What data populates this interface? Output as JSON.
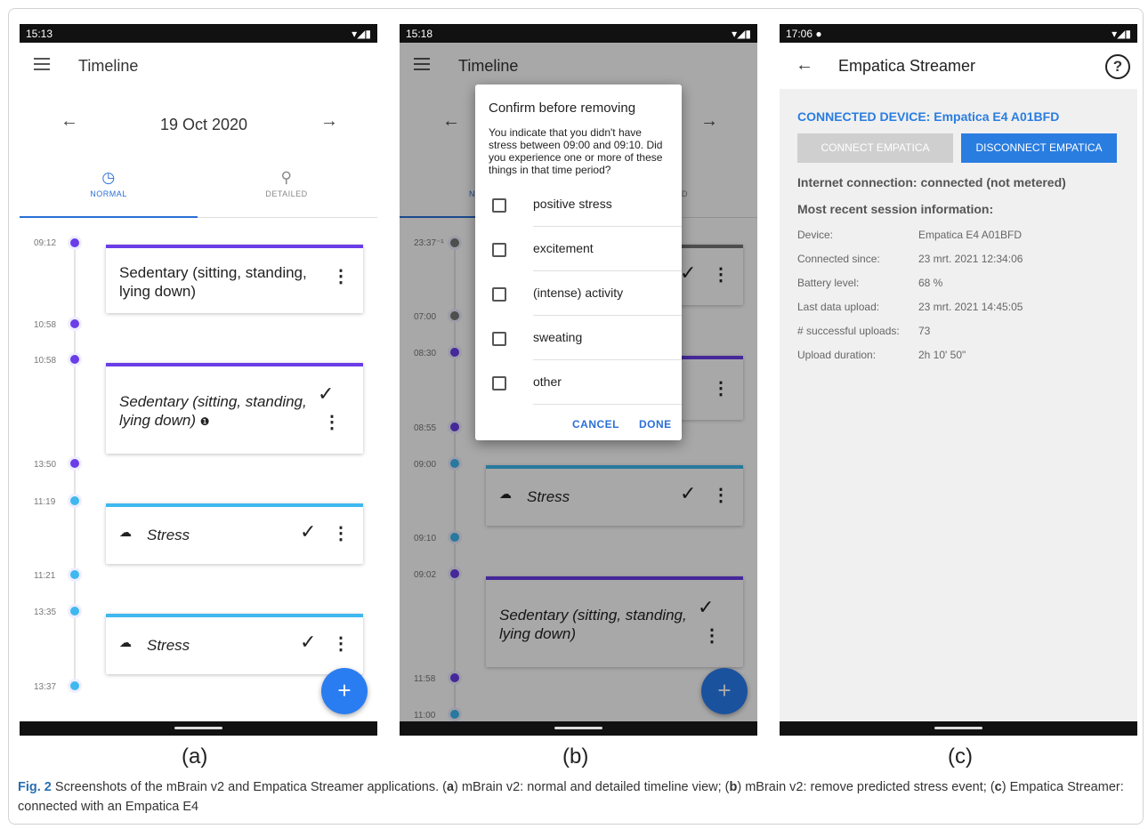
{
  "panel_a": {
    "status": {
      "time": "15:13"
    },
    "title": "Timeline",
    "date": "19 Oct 2020",
    "prev": "←",
    "next": "→",
    "tabs": [
      {
        "label": "NORMAL"
      },
      {
        "label": "DETAILED"
      }
    ],
    "times": [
      "09:12",
      "10:58",
      "10:58",
      "13:50",
      "11:19",
      "11:21",
      "13:35",
      "13:37"
    ],
    "cards": [
      {
        "text": "Sedentary (sitting, standing, lying down)"
      },
      {
        "text": "Sedentary (sitting, standing, lying down)"
      },
      {
        "text": "Stress"
      },
      {
        "text": "Stress"
      }
    ],
    "fab": "+",
    "label": "(a)"
  },
  "panel_b": {
    "status": {
      "time": "15:18"
    },
    "title": "Timeline",
    "prev": "←",
    "next": "→",
    "tab_fragment_1": "N",
    "tab_fragment_2": "D",
    "times": [
      "23:37⁻¹",
      "07:00",
      "08:30",
      "08:55",
      "09:00",
      "09:10",
      "09:02",
      "11:58",
      "11:00"
    ],
    "dialog": {
      "title": "Confirm before removing",
      "message": "You indicate that you didn't have stress between 09:00 and 09:10. Did you experience one or more of these things in that time period?",
      "options": [
        "positive stress",
        "excitement",
        "(intense) activity",
        "sweating",
        "other"
      ],
      "cancel": "CANCEL",
      "done": "DONE"
    },
    "cards": [
      {
        "text": "Stress"
      },
      {
        "text": "Sedentary (sitting, standing, lying down)"
      }
    ],
    "fab": "+",
    "label": "(b)"
  },
  "panel_c": {
    "status": {
      "time": "17:06"
    },
    "title": "Empatica Streamer",
    "back": "←",
    "help": "?",
    "connected_device": "CONNECTED DEVICE: Empatica E4 A01BFD",
    "connect_btn": "CONNECT EMPATICA",
    "disconnect_btn": "DISCONNECT EMPATICA",
    "internet": "Internet connection:  connected (not metered)",
    "recent": "Most recent session information:",
    "info": [
      {
        "k": "Device:",
        "v": "Empatica E4 A01BFD"
      },
      {
        "k": "Connected since:",
        "v": "23 mrt. 2021 12:34:06"
      },
      {
        "k": "Battery level:",
        "v": "68 %"
      },
      {
        "k": "Last data upload:",
        "v": "23 mrt. 2021 14:45:05"
      },
      {
        "k": "# successful uploads:",
        "v": "73"
      },
      {
        "k": "Upload duration:",
        "v": "2h 10' 50\""
      }
    ],
    "label": "(c)"
  },
  "caption": {
    "fig": "Fig. 2",
    "text1": "  Screenshots of the mBrain v2 and Empatica Streamer applications. (",
    "a": "a",
    "text2": ") mBrain v2: normal and detailed timeline view; (",
    "b": "b",
    "text3": ") mBrain v2: remove predicted stress event; (",
    "c": "c",
    "text4": ") Empatica Streamer: connected with an Empatica E4"
  },
  "colors": {
    "purple": "#6a3de8",
    "blue": "#3fb8f0",
    "accent": "#2a6fd6"
  }
}
